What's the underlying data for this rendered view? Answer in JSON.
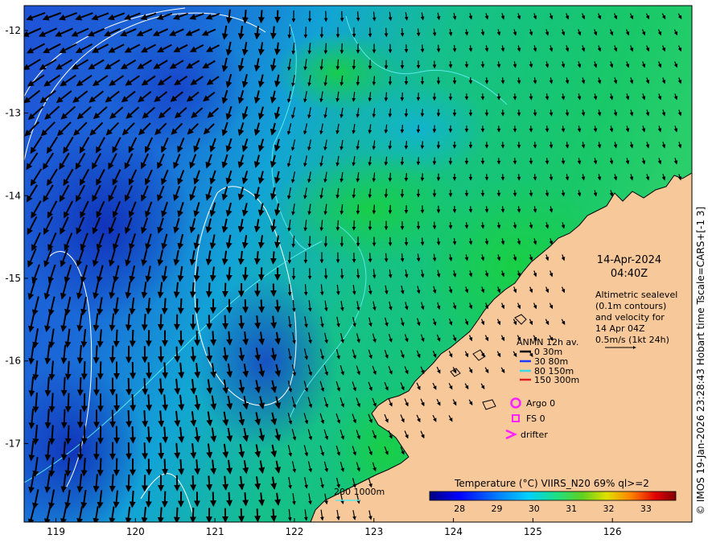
{
  "map": {
    "date": "14-Apr-2024",
    "time": "04:40Z",
    "info_lines": [
      "Altimetric sealevel",
      "(0.1m contours)",
      "and velocity for",
      "14 Apr 04Z",
      "0.5m/s (1kt 24h)"
    ],
    "lon_ticks": [
      "119",
      "120",
      "121",
      "122",
      "123",
      "124",
      "125",
      "126"
    ],
    "lat_ticks": [
      "-12",
      "-13",
      "-14",
      "-15",
      "-16",
      "-17"
    ],
    "lon_range": [
      118.6,
      127.0
    ],
    "lat_range": [
      -17.95,
      -11.7
    ],
    "colors": {
      "land": "#f7c89a",
      "ocean_cold": "#1c4bd0",
      "ocean_warm": "#1fbf58",
      "arrow": "#000000",
      "contour": "#ffffff",
      "contour_cyan": "#5ce8e8"
    }
  },
  "legend": {
    "title": "ANMN 12h av.",
    "items": [
      {
        "label": "0 30m",
        "color": "#000000"
      },
      {
        "label": "30 80m",
        "color": "#1a3cff"
      },
      {
        "label": "80 150m",
        "color": "#3fd9e6"
      },
      {
        "label": "150 300m",
        "color": "#e02020"
      }
    ],
    "argo": "Argo 0",
    "fs": "FS 0",
    "drifter": "drifter",
    "marker_color": "#ff20ff"
  },
  "bathymetry": {
    "label": "200  1000m"
  },
  "colorbar": {
    "title": "Temperature (°C) VIIRS_N20 69% ql>=2",
    "ticks": [
      "28",
      "29",
      "30",
      "31",
      "32",
      "33"
    ],
    "range": [
      27.2,
      33.8
    ],
    "stops": [
      "#000080",
      "#0000ff",
      "#0080ff",
      "#00d0ff",
      "#20e080",
      "#60d020",
      "#e0e000",
      "#ff8000",
      "#e00000",
      "#800000"
    ]
  },
  "footer": {
    "copyright": "© IMOS 19-Jan-2026 23:28:43 Hobart time Tscale=CARS+[-1 3]"
  }
}
